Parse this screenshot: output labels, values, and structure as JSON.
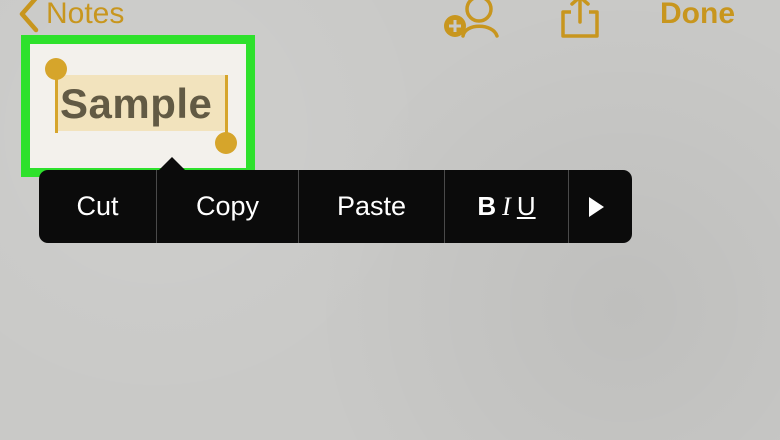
{
  "nav": {
    "back_label": "Notes",
    "done_label": "Done",
    "icons": {
      "back": "chevron-left-icon",
      "collaborate": "add-person-icon",
      "share": "share-icon"
    },
    "accent_color": "#c8961e"
  },
  "note": {
    "selected_text": "Sample",
    "highlight_color": "#2ee12c",
    "selection_color": "#f2e3bd",
    "handle_color": "#d6a52b"
  },
  "edit_menu": {
    "items": [
      "Cut",
      "Copy",
      "Paste"
    ],
    "format": {
      "bold": "B",
      "italic": "I",
      "underline": "U"
    },
    "more_icon": "play-right-icon"
  }
}
